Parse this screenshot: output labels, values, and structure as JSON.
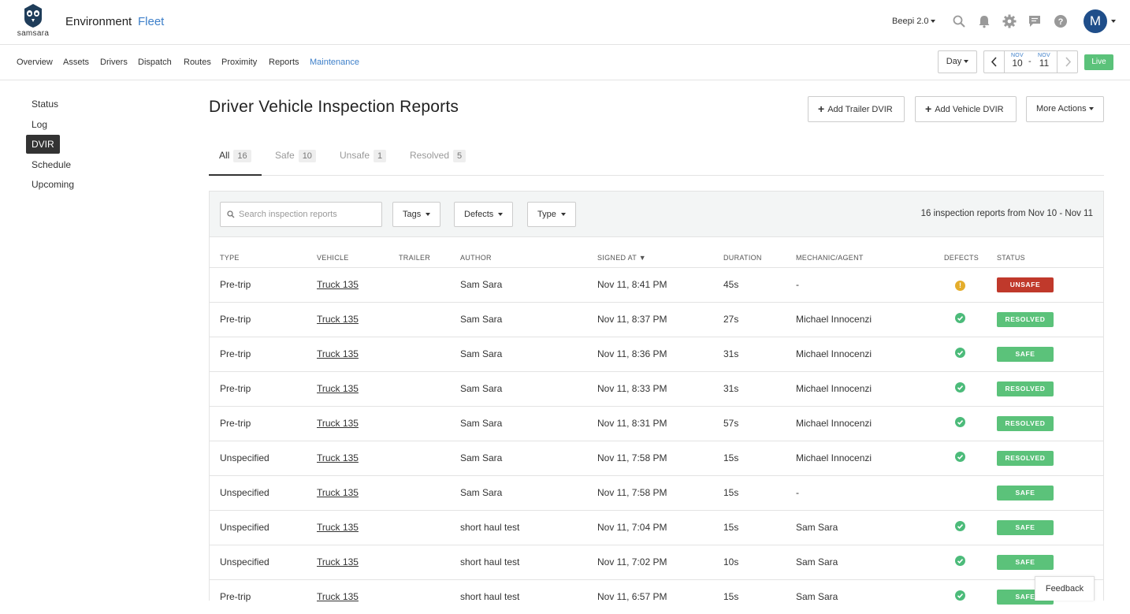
{
  "header": {
    "logo_text": "samsara",
    "title": "Environment",
    "subtitle": "Fleet",
    "org": "Beepi 2.0",
    "avatar_initial": "M",
    "icons": [
      "search-icon",
      "bell-icon",
      "gear-icon",
      "chat-icon",
      "help-icon"
    ]
  },
  "nav": {
    "items": [
      "Overview",
      "Assets",
      "Drivers",
      "Dispatch",
      "Routes",
      "Proximity",
      "Reports",
      "Maintenance"
    ],
    "active": "Maintenance",
    "range": "Day",
    "date_from_month": "NOV",
    "date_from_day": "10",
    "date_sep": "-",
    "date_to_month": "NOV",
    "date_to_day": "11",
    "live": "Live"
  },
  "sidebar": {
    "items": [
      "Status",
      "Log",
      "DVIR",
      "Schedule",
      "Upcoming"
    ],
    "active": "DVIR"
  },
  "main": {
    "title": "Driver Vehicle Inspection Reports",
    "actions": [
      "Add Trailer DVIR",
      "Add Vehicle DVIR",
      "More Actions"
    ],
    "tabs": [
      {
        "label": "All",
        "count": "16"
      },
      {
        "label": "Safe",
        "count": "10"
      },
      {
        "label": "Unsafe",
        "count": "1"
      },
      {
        "label": "Resolved",
        "count": "5"
      }
    ],
    "search_placeholder": "Search inspection reports",
    "filters": [
      "Tags",
      "Defects",
      "Type"
    ],
    "summary": "16 inspection reports from Nov 10 - Nov 11",
    "columns": [
      "TYPE",
      "VEHICLE",
      "TRAILER",
      "AUTHOR",
      "SIGNED AT",
      "DURATION",
      "MECHANIC/AGENT",
      "DEFECTS",
      "STATUS"
    ],
    "rows": [
      {
        "type": "Pre-trip",
        "vehicle": "Truck 135",
        "trailer": "",
        "author": "Sam Sara",
        "signed": "Nov 11, 8:41 PM",
        "duration": "45s",
        "mechanic": "-",
        "defect": "warning",
        "status": "UNSAFE"
      },
      {
        "type": "Pre-trip",
        "vehicle": "Truck 135",
        "trailer": "",
        "author": "Sam Sara",
        "signed": "Nov 11, 8:37 PM",
        "duration": "27s",
        "mechanic": "Michael Innocenzi",
        "defect": "check",
        "status": "RESOLVED"
      },
      {
        "type": "Pre-trip",
        "vehicle": "Truck 135",
        "trailer": "",
        "author": "Sam Sara",
        "signed": "Nov 11, 8:36 PM",
        "duration": "31s",
        "mechanic": "Michael Innocenzi",
        "defect": "check",
        "status": "SAFE"
      },
      {
        "type": "Pre-trip",
        "vehicle": "Truck 135",
        "trailer": "",
        "author": "Sam Sara",
        "signed": "Nov 11, 8:33 PM",
        "duration": "31s",
        "mechanic": "Michael Innocenzi",
        "defect": "check",
        "status": "RESOLVED"
      },
      {
        "type": "Pre-trip",
        "vehicle": "Truck 135",
        "trailer": "",
        "author": "Sam Sara",
        "signed": "Nov 11, 8:31 PM",
        "duration": "57s",
        "mechanic": "Michael Innocenzi",
        "defect": "check",
        "status": "RESOLVED"
      },
      {
        "type": "Unspecified",
        "vehicle": "Truck 135",
        "trailer": "",
        "author": "Sam Sara",
        "signed": "Nov 11, 7:58 PM",
        "duration": "15s",
        "mechanic": "Michael Innocenzi",
        "defect": "check",
        "status": "RESOLVED"
      },
      {
        "type": "Unspecified",
        "vehicle": "Truck 135",
        "trailer": "",
        "author": "Sam Sara",
        "signed": "Nov 11, 7:58 PM",
        "duration": "15s",
        "mechanic": "-",
        "defect": "none",
        "status": "SAFE"
      },
      {
        "type": "Unspecified",
        "vehicle": "Truck 135",
        "trailer": "",
        "author": "short haul test",
        "signed": "Nov 11, 7:04 PM",
        "duration": "15s",
        "mechanic": "Sam Sara",
        "defect": "check",
        "status": "SAFE"
      },
      {
        "type": "Unspecified",
        "vehicle": "Truck 135",
        "trailer": "",
        "author": "short haul test",
        "signed": "Nov 11, 7:02 PM",
        "duration": "10s",
        "mechanic": "Sam Sara",
        "defect": "check",
        "status": "SAFE"
      },
      {
        "type": "Pre-trip",
        "vehicle": "Truck 135",
        "trailer": "",
        "author": "short haul test",
        "signed": "Nov 11, 6:57 PM",
        "duration": "15s",
        "mechanic": "Sam Sara",
        "defect": "check",
        "status": "SAFE"
      }
    ],
    "feedback": "Feedback"
  },
  "colors": {
    "accent": "#3d7fc9",
    "safe": "#5bc27a",
    "unsafe": "#c0392b",
    "warning": "#e4ad2b",
    "avatar": "#1f4e8a"
  }
}
